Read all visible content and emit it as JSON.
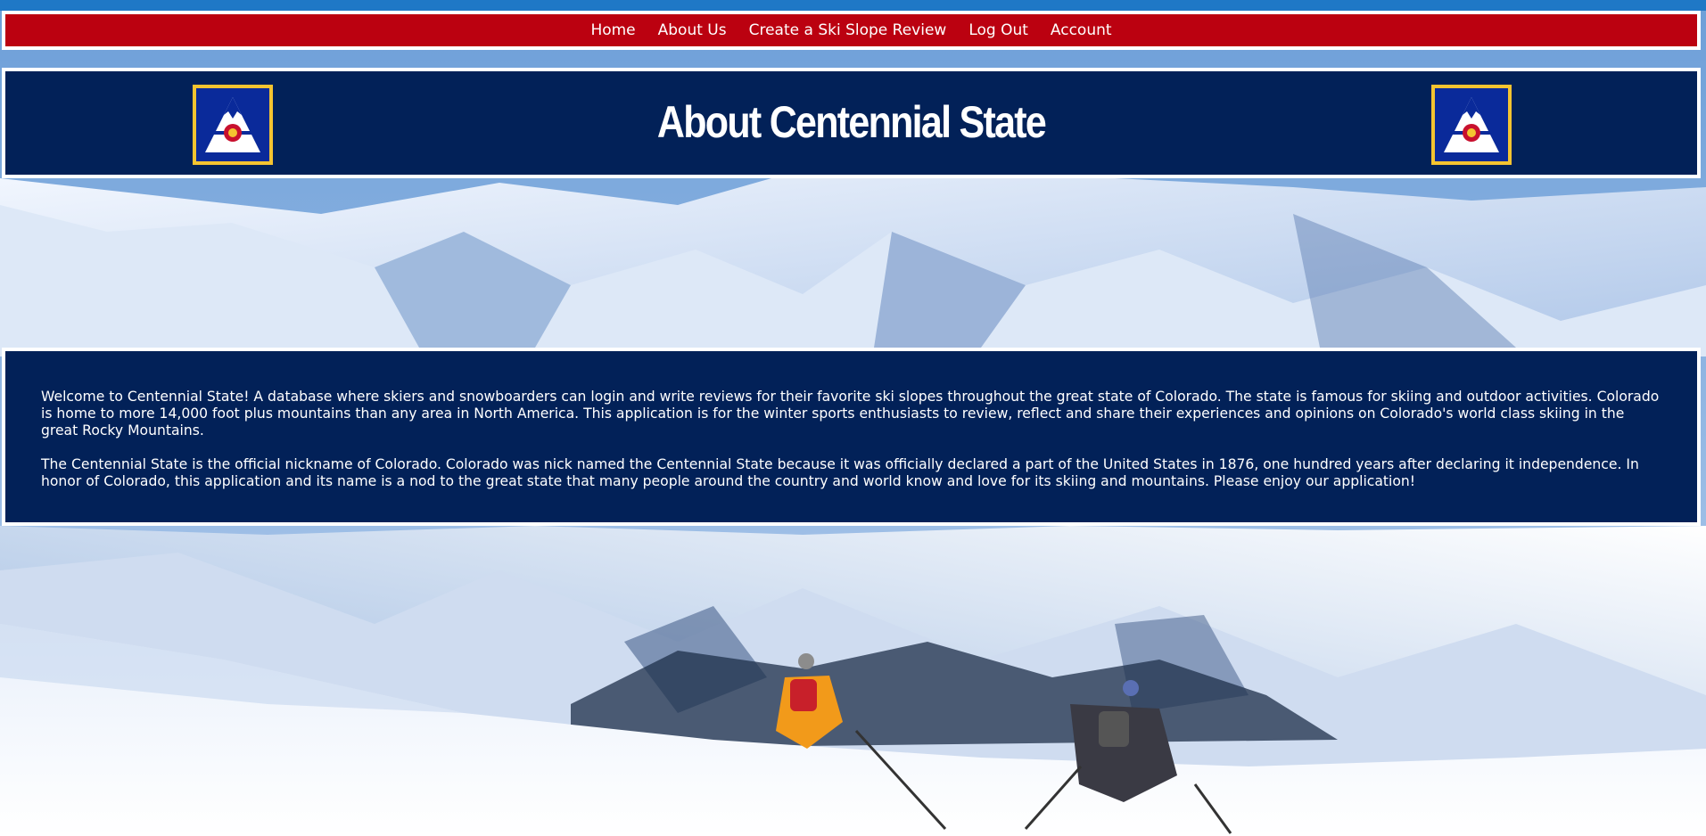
{
  "colors": {
    "nav_bg": "#bb0110",
    "panel_bg": "#022158",
    "border": "#ffffff",
    "logo_gold": "#f4c430",
    "logo_blue": "#0a2a9a",
    "logo_red": "#c8102e"
  },
  "nav": {
    "items": [
      {
        "label": "Home"
      },
      {
        "label": "About Us"
      },
      {
        "label": "Create a Ski Slope Review"
      },
      {
        "label": "Log Out"
      },
      {
        "label": "Account"
      }
    ]
  },
  "banner": {
    "title": "About Centennial State",
    "logo_icon": "colorado-mountain-logo"
  },
  "about": {
    "paragraph_1": "Welcome to Centennial State! A database where skiers and snowboarders can login and write reviews for their favorite ski slopes throughout the great state of Colorado. The state is famous for skiing and outdoor activities. Colorado is home to more 14,000 foot plus mountains than any area in North America. This application is for the winter sports enthusiasts to review, reflect and share their experiences and opinions on Colorado's world class skiing in the great Rocky Mountains.",
    "paragraph_2": "The Centennial State is the official nickname of Colorado. Colorado was nick named the Centennial State because it was officially declared a part of the United States in 1876, one hundred years after declaring it independence. In honor of Colorado, this application and its name is a nod to the great state that many people around the country and world know and love for its skiing and mountains. Please enjoy our application!"
  }
}
